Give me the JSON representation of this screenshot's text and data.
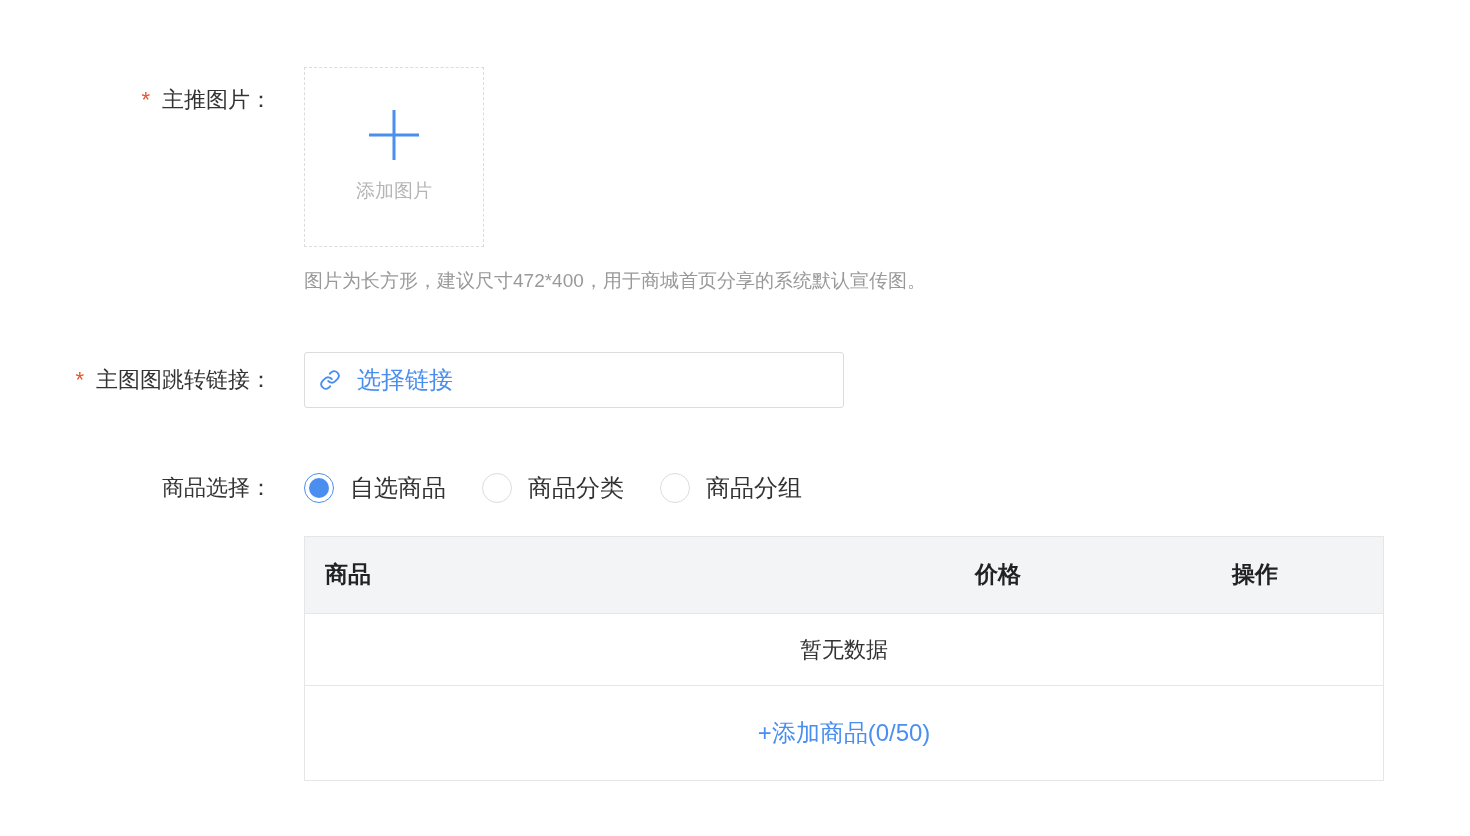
{
  "fields": [
    {
      "kind": "upload",
      "required_mark": "*",
      "label": "主推图片：",
      "upload_text": "添加图片",
      "hint": "图片为长方形，建议尺寸472*400，用于商城首页分享的系统默认宣传图。"
    },
    {
      "kind": "link",
      "required_mark": "*",
      "label": "主图图跳转链接：",
      "link_text": "选择链接"
    },
    {
      "kind": "radio",
      "label": "商品选择：",
      "options": [
        {
          "label": "自选商品",
          "selected": true
        },
        {
          "label": "商品分类",
          "selected": false
        },
        {
          "label": "商品分组",
          "selected": false
        }
      ]
    }
  ],
  "table": {
    "columns": [
      "商品",
      "价格",
      "操作"
    ],
    "empty_text": "暂无数据",
    "add_text": "+添加商品(0/50)"
  }
}
